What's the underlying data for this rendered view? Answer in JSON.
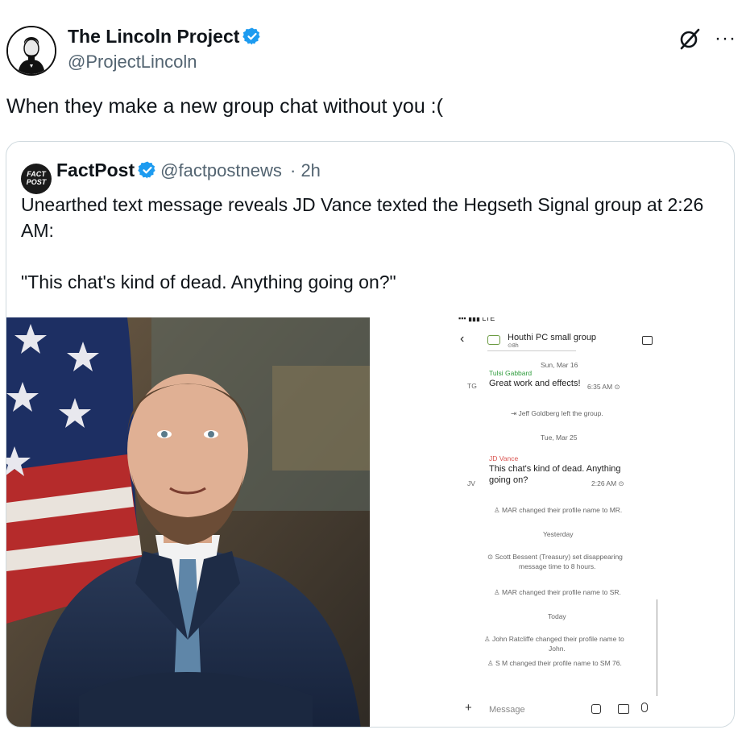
{
  "author": {
    "name": "The Lincoln Project",
    "handle": "@ProjectLincoln"
  },
  "colors": {
    "verified": "#1d9bf0",
    "vance_name": "#d9534f",
    "tulsi_name": "#2e9c3c"
  },
  "tweet": {
    "text": "When they make a new group chat without you :("
  },
  "quote": {
    "name": "FactPost",
    "handle": "@factpostnews",
    "time": "· 2h",
    "logo": [
      "FACT",
      "POST"
    ],
    "line1": "Unearthed text message reveals JD Vance texted the Hegseth Signal group at 2:26 AM:",
    "line2": "\"This chat's kind of dead. Anything going on?\""
  },
  "phone": {
    "group": "Houthi PC small group",
    "group_sub": "⊙8h",
    "date1": "Sun, Mar 16",
    "tg_initials": "TG",
    "tg_name": "Tulsi Gabbard",
    "tg_msg": "Great work and effects!",
    "tg_time": "6:35 AM ⊙",
    "left": "Jeff Goldberg left the group.",
    "date2": "Tue, Mar 25",
    "jv_initials": "JV",
    "jv_name": "JD Vance",
    "jv_msg1": "This chat's kind of dead. Anything",
    "jv_msg2": "going on?",
    "jv_time": "2:26 AM ⊙",
    "ev1": "MAR changed their profile name to MR.",
    "yesterday": "Yesterday",
    "ev2a": "Scott Bessent (Treasury) set disappearing",
    "ev2b": "message time to 8 hours.",
    "ev3": "MAR changed their profile name to SR.",
    "today": "Today",
    "ev4a": "John Ratcliffe changed their profile name to",
    "ev4b": "John.",
    "ev5": "S M changed their profile name to SM 76.",
    "message_placeholder": "Message"
  }
}
